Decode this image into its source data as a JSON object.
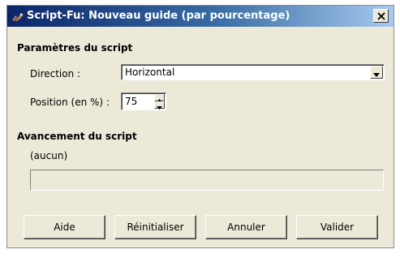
{
  "window": {
    "title": "Script-Fu: Nouveau guide (par pourcentage)",
    "close_glyph": "×"
  },
  "params": {
    "section_title": "Paramètres du script",
    "direction_label": "Direction :",
    "direction_value": "Horizontal",
    "position_label": "Position (en %) :",
    "position_value": "75"
  },
  "progress": {
    "section_title": "Avancement du script",
    "status": "(aucun)",
    "fraction": 0
  },
  "buttons": {
    "help": "Aide",
    "reset": "Réinitialiser",
    "cancel": "Annuler",
    "ok": "Valider"
  },
  "colors": {
    "titlebar_start": "#0a246a",
    "titlebar_end": "#a6caf0",
    "dialog_bg": "#ece9d8"
  },
  "icons": {
    "title": "gimp-wilber-icon",
    "close": "close-icon",
    "dropdown": "chevron-down-icon"
  }
}
